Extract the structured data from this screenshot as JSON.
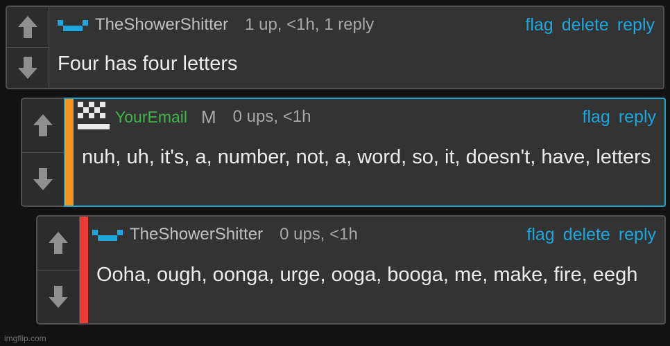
{
  "comments": [
    {
      "username": "TheShowerShitter",
      "meta": "1 up, <1h, 1 reply",
      "text": "Four has four letters",
      "actions": [
        "flag",
        "delete",
        "reply"
      ]
    },
    {
      "username": "YourEmail",
      "mod_badge": "M",
      "meta": "0 ups, <1h",
      "text": "nuh, uh, it's, a, number, not, a, word, so, it, doesn't, have, letters",
      "actions": [
        "flag",
        "reply"
      ],
      "accent_color": "#f7941d"
    },
    {
      "username": "TheShowerShitter",
      "meta": "0 ups, <1h",
      "text": "Ooha, ough, oonga, urge, ooga, booga, me, make, fire, eegh",
      "actions": [
        "flag",
        "delete",
        "reply"
      ],
      "accent_color": "#ef3b36"
    }
  ],
  "watermark": "imgflip.com",
  "colors": {
    "link": "#1aa8de",
    "username_mod": "#3fb54c",
    "selected_border": "#1aa4d0"
  }
}
